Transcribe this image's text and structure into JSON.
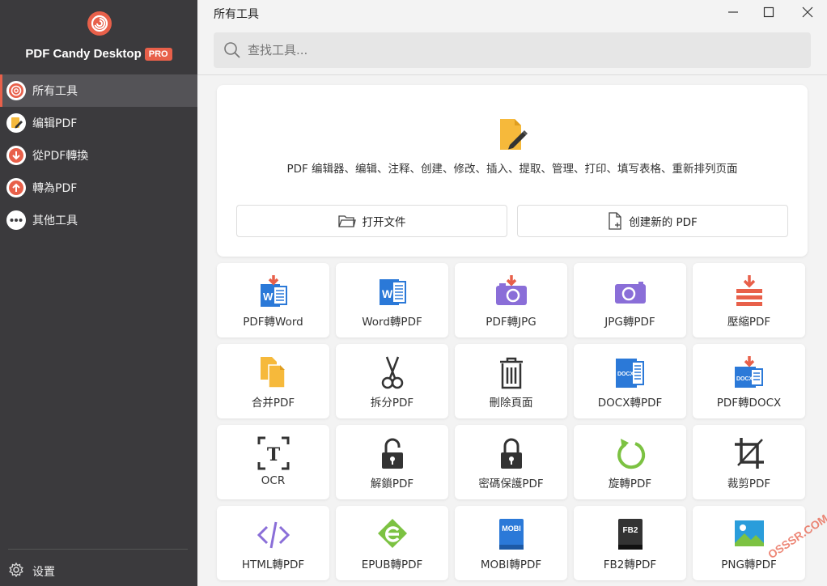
{
  "app": {
    "brand_name": "PDF Candy Desktop",
    "brand_badge": "PRO",
    "accent_color": "#e8604a",
    "sidebar_bg": "#3b3a3d"
  },
  "sidebar": {
    "items": [
      {
        "label": "所有工具",
        "icon": "spiral-icon",
        "active": true
      },
      {
        "label": "编辑PDF",
        "icon": "pencil-icon",
        "active": false
      },
      {
        "label": "從PDF轉換",
        "icon": "arrow-down-icon",
        "active": false
      },
      {
        "label": "轉為PDF",
        "icon": "arrow-up-icon",
        "active": false
      },
      {
        "label": "其他工具",
        "icon": "more-dots-icon",
        "active": false
      }
    ],
    "settings_label": "设置"
  },
  "header": {
    "title": "所有工具",
    "window_buttons": [
      "minimize",
      "maximize",
      "close"
    ]
  },
  "search": {
    "placeholder": "查找工具..."
  },
  "hero": {
    "icon": "pdf-edit-icon",
    "description": "PDF 编辑器、编辑、注释、创建、修改、插入、提取、管理、打印、填写表格、重新排列页面",
    "open_file_label": "打开文件",
    "create_pdf_label": "创建新的 PDF"
  },
  "tools": [
    {
      "label": "PDF轉Word",
      "icon": "pdf-to-word-icon"
    },
    {
      "label": "Word轉PDF",
      "icon": "word-to-pdf-icon"
    },
    {
      "label": "PDF轉JPG",
      "icon": "pdf-to-jpg-icon"
    },
    {
      "label": "JPG轉PDF",
      "icon": "jpg-to-pdf-icon"
    },
    {
      "label": "壓縮PDF",
      "icon": "compress-icon"
    },
    {
      "label": "合并PDF",
      "icon": "merge-icon"
    },
    {
      "label": "拆分PDF",
      "icon": "scissors-icon"
    },
    {
      "label": "刪除頁面",
      "icon": "trash-icon"
    },
    {
      "label": "DOCX轉PDF",
      "icon": "docx-to-pdf-icon"
    },
    {
      "label": "PDF轉DOCX",
      "icon": "pdf-to-docx-icon"
    },
    {
      "label": "OCR",
      "icon": "ocr-icon"
    },
    {
      "label": "解鎖PDF",
      "icon": "unlock-icon"
    },
    {
      "label": "密碼保護PDF",
      "icon": "lock-icon"
    },
    {
      "label": "旋轉PDF",
      "icon": "rotate-icon"
    },
    {
      "label": "裁剪PDF",
      "icon": "crop-icon"
    },
    {
      "label": "HTML轉PDF",
      "icon": "html-code-icon"
    },
    {
      "label": "EPUB轉PDF",
      "icon": "epub-icon"
    },
    {
      "label": "MOBI轉PDF",
      "icon": "mobi-icon"
    },
    {
      "label": "FB2轉PDF",
      "icon": "fb2-icon"
    },
    {
      "label": "PNG轉PDF",
      "icon": "png-image-icon"
    }
  ],
  "icon_text": {
    "docx": "DOCX",
    "mobi": "MOBI",
    "fb2": "FB2",
    "word_letter": "W",
    "ocr_letter": "T",
    "html_code": "</>"
  },
  "watermark": "OSSSR.COM"
}
